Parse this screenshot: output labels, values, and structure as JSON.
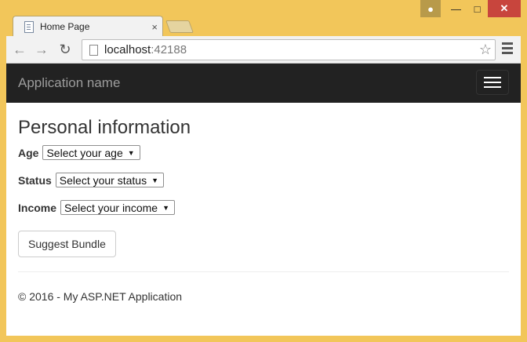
{
  "browser": {
    "tab_title": "Home Page",
    "tab_close": "×",
    "url_host": "localhost",
    "url_port": ":42188"
  },
  "app": {
    "brand": "Application name"
  },
  "form": {
    "heading": "Personal information",
    "age_label": "Age",
    "age_value": "Select your age",
    "status_label": "Status",
    "status_value": "Select your status",
    "income_label": "Income",
    "income_value": "Select your income",
    "submit_label": "Suggest Bundle"
  },
  "footer": {
    "text": "© 2016 - My ASP.NET Application"
  }
}
